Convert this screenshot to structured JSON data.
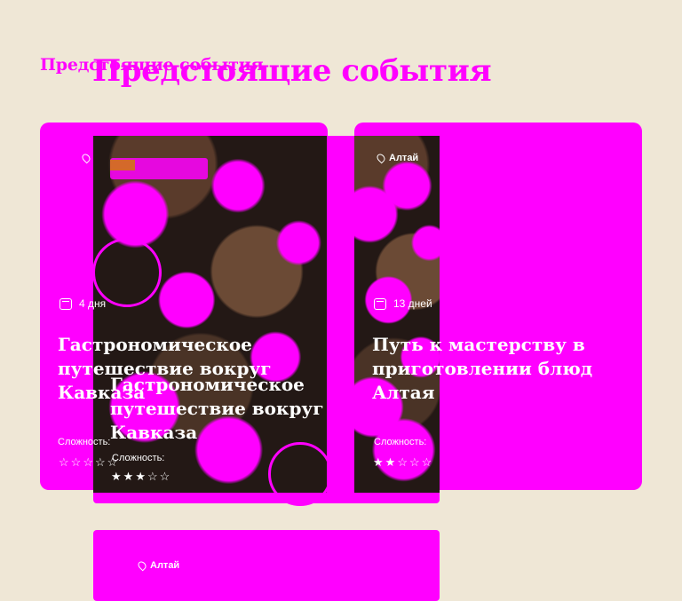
{
  "section": {
    "title": "Предстоящие события"
  },
  "cards": [
    {
      "duration": "4 дня",
      "title": "Гастрономическое путешествие вокруг Кавказа",
      "difficulty_label": "Сложность:",
      "difficulty": 0,
      "difficulty_max": 5
    },
    {
      "duration": "13 дней",
      "location": "Алтай",
      "title": "Путь к мастерству в приготовлении блюд Алтая",
      "difficulty_label": "Сложность:",
      "difficulty": 2,
      "difficulty_max": 5
    },
    {
      "title": "Гастрономическое путешествие вокруг Кавказа",
      "difficulty_label": "Сложность:",
      "difficulty": 3,
      "difficulty_max": 5
    },
    {
      "location": "Алтай"
    }
  ],
  "colors": {
    "background": "#efe7d6",
    "accent": "#ff00ff",
    "badge_orange": "#d4692a",
    "text_on_card": "#ffffff"
  },
  "icons": {
    "location": "pin-icon",
    "duration": "calendar-icon",
    "rating": "star-icon"
  }
}
